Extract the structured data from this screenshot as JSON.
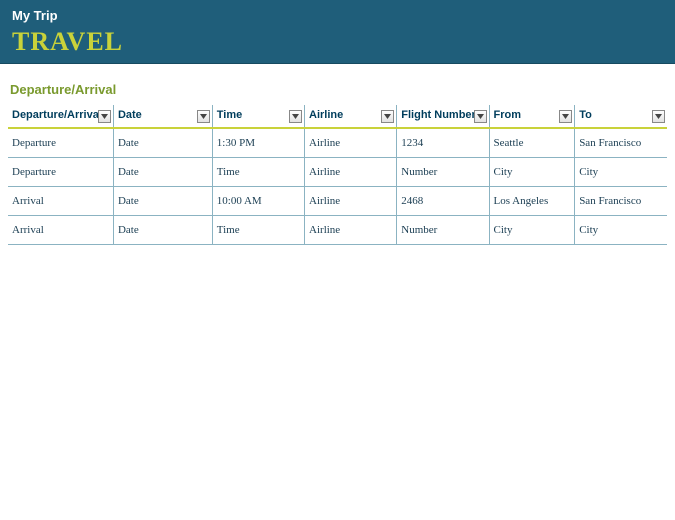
{
  "header": {
    "trip_name": "My Trip",
    "title": "TRAVEL"
  },
  "section": {
    "title": "Departure/Arrival"
  },
  "table": {
    "headers": [
      "Departure/Arrival",
      "Date",
      "Time",
      "Airline",
      "Flight Number",
      "From",
      "To"
    ],
    "rows": [
      [
        "Departure",
        "Date",
        "1:30 PM",
        "Airline",
        "1234",
        "Seattle",
        "San Francisco"
      ],
      [
        "Departure",
        "Date",
        "Time",
        "Airline",
        "Number",
        "City",
        "City"
      ],
      [
        "Arrival",
        "Date",
        "10:00 AM",
        "Airline",
        "2468",
        "Los Angeles",
        "San Francisco"
      ],
      [
        "Arrival",
        "Date",
        "Time",
        "Airline",
        "Number",
        "City",
        "City"
      ]
    ]
  },
  "colors": {
    "header_bg": "#1f5e7a",
    "accent_yellow": "#c9d23a",
    "section_green": "#7a9a2e",
    "text_dark": "#003d5c",
    "border_blue": "#8bb3c2"
  }
}
